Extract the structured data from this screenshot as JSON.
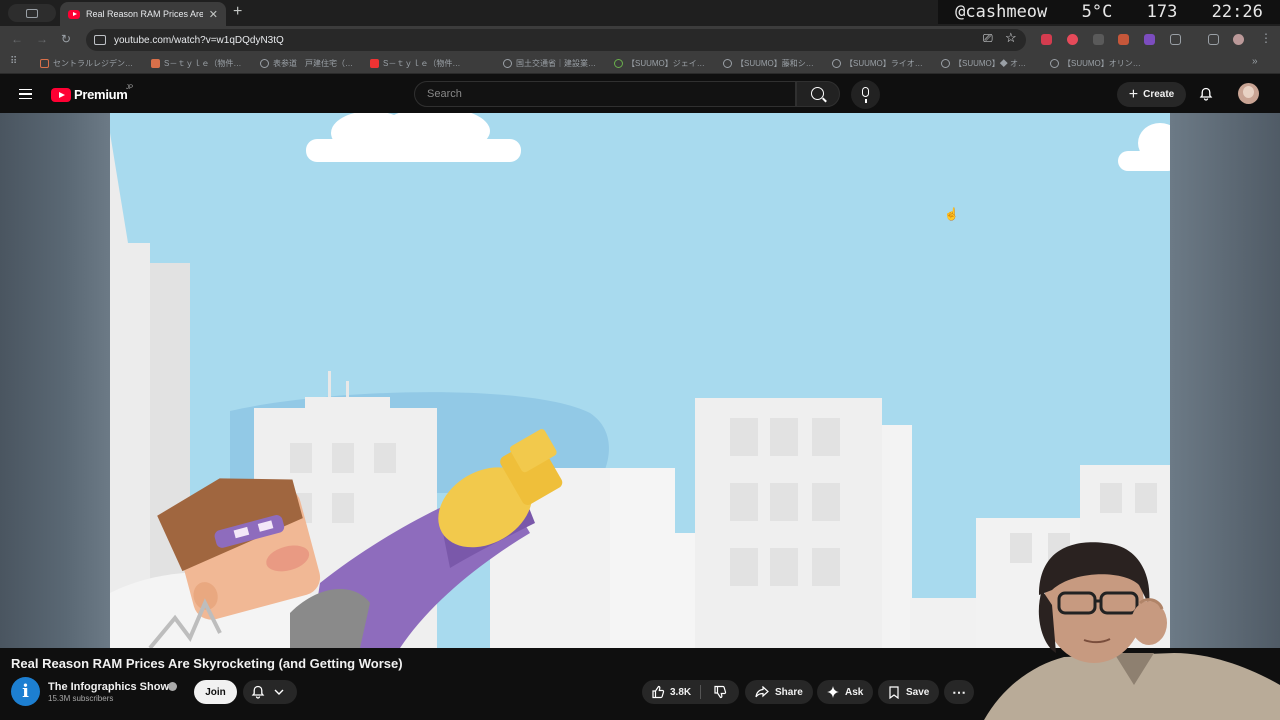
{
  "browser": {
    "tab_title": "Real Reason RAM Prices Are",
    "url": "youtube.com/watch?v=w1qDQdyN3tQ",
    "bookmarks": [
      "セントラルレジデン…",
      "S－ｔｙｌｅ（物件…",
      "表参道　戸建住宅（…",
      "S－ｔｙｌｅ（物件…",
      "国土交通省｜建設業…",
      "【SUUMO】ジェイ…",
      "【SUUMO】藤和シ…",
      "【SUUMO】ライオ…",
      "【SUUMO】◆ オ…",
      "【SUUMO】オリン…"
    ]
  },
  "overlay": {
    "handle": "@cashmeow",
    "temperature": "5°C",
    "number": "173",
    "time": "22:26"
  },
  "header": {
    "logo_text": "Premium",
    "logo_region": "JP",
    "search_placeholder": "Search",
    "create_label": "Create"
  },
  "video": {
    "title": "Real Reason RAM Prices Are Skyrocketing (and Getting Worse)",
    "channel_name": "The Infographics Show",
    "channel_initial": "i",
    "subscribers": "15.3M subscribers",
    "join_label": "Join",
    "like_count": "3.8K",
    "share_label": "Share",
    "ask_label": "Ask",
    "save_label": "Save"
  },
  "colors": {
    "brand_red": "#ff0033",
    "sky": "#a8daee",
    "building": "#efefef",
    "cape_purple": "#8e6cbd",
    "fist_yellow": "#f2c94c",
    "hair_brown": "#a0663f",
    "skin": "#f1b895"
  }
}
